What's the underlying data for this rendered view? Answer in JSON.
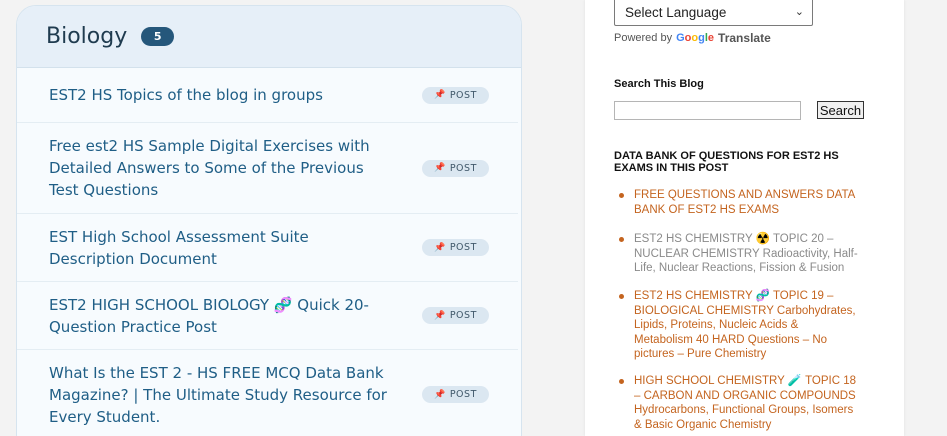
{
  "card": {
    "title": "Biology",
    "count": "5",
    "posts": [
      {
        "title": "EST2 HS Topics of the blog in groups",
        "badge": "POST"
      },
      {
        "title": "Free est2 HS Sample Digital Exercises with Detailed Answers to Some of the Previous Test Questions",
        "badge": "POST"
      },
      {
        "title": "EST High School Assessment Suite Description Document",
        "badge": "POST"
      },
      {
        "title": "EST2 HIGH SCHOOL BIOLOGY 🧬 Quick 20-Question Practice Post",
        "badge": "POST"
      },
      {
        "title": "What Is the EST 2 - HS FREE MCQ Data Bank Magazine? | The Ultimate Study Resource for Every Student.",
        "badge": "POST"
      }
    ]
  },
  "translate": {
    "select_value": "Select Language",
    "powered_by": "Powered by",
    "google": [
      "G",
      "o",
      "o",
      "g",
      "l",
      "e"
    ],
    "translate_label": "Translate"
  },
  "search": {
    "title": "Search This Blog",
    "button_label": "Search",
    "value": "",
    "placeholder": ""
  },
  "bank": {
    "title": "DATA BANK OF QUESTIONS FOR EST2 HS EXAMS IN THIS POST",
    "items": [
      {
        "text": "FREE QUESTIONS AND ANSWERS DATA BANK OF EST2 HS EXAMS",
        "color": "orange"
      },
      {
        "text": "EST2 HS CHEMISTRY ☢️ TOPIC 20 – NUCLEAR CHEMISTRY Radioactivity, Half-Life, Nuclear Reactions, Fission & Fusion",
        "color": "grey"
      },
      {
        "text": "EST2 HS CHEMISTRY 🧬 TOPIC 19 – BIOLOGICAL CHEMISTRY Carbohydrates, Lipids, Proteins, Nucleic Acids & Metabolism 40 HARD Questions – No pictures – Pure Chemistry",
        "color": "orange"
      },
      {
        "text": "HIGH SCHOOL CHEMISTRY 🧪 TOPIC 18 – CARBON AND ORGANIC COMPOUNDS Hydrocarbons, Functional Groups, Isomers & Basic Organic Chemistry",
        "color": "orange"
      }
    ]
  },
  "colors": {
    "link_blue": "#1f5e86",
    "badge_dark": "#25577b",
    "sidebar_orange": "#c4641f"
  }
}
